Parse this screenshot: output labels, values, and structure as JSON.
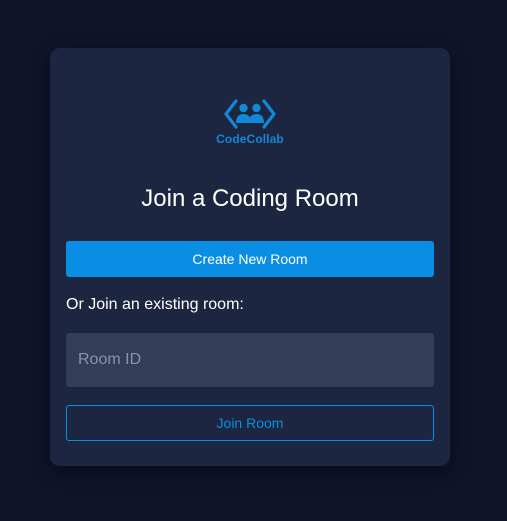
{
  "brand": {
    "name": "CodeCollab",
    "icon": "code-users-icon",
    "color": "#1387d8"
  },
  "title": "Join a Coding Room",
  "create_button": {
    "label": "Create New Room",
    "color": "#0a8ee4"
  },
  "join_prompt": "Or Join an existing room:",
  "room_input": {
    "placeholder": "Room ID",
    "value": ""
  },
  "join_button": {
    "label": "Join Room"
  },
  "colors": {
    "page_background": "#10142b",
    "card_background": "#1c2640",
    "input_background": "#323e58"
  }
}
